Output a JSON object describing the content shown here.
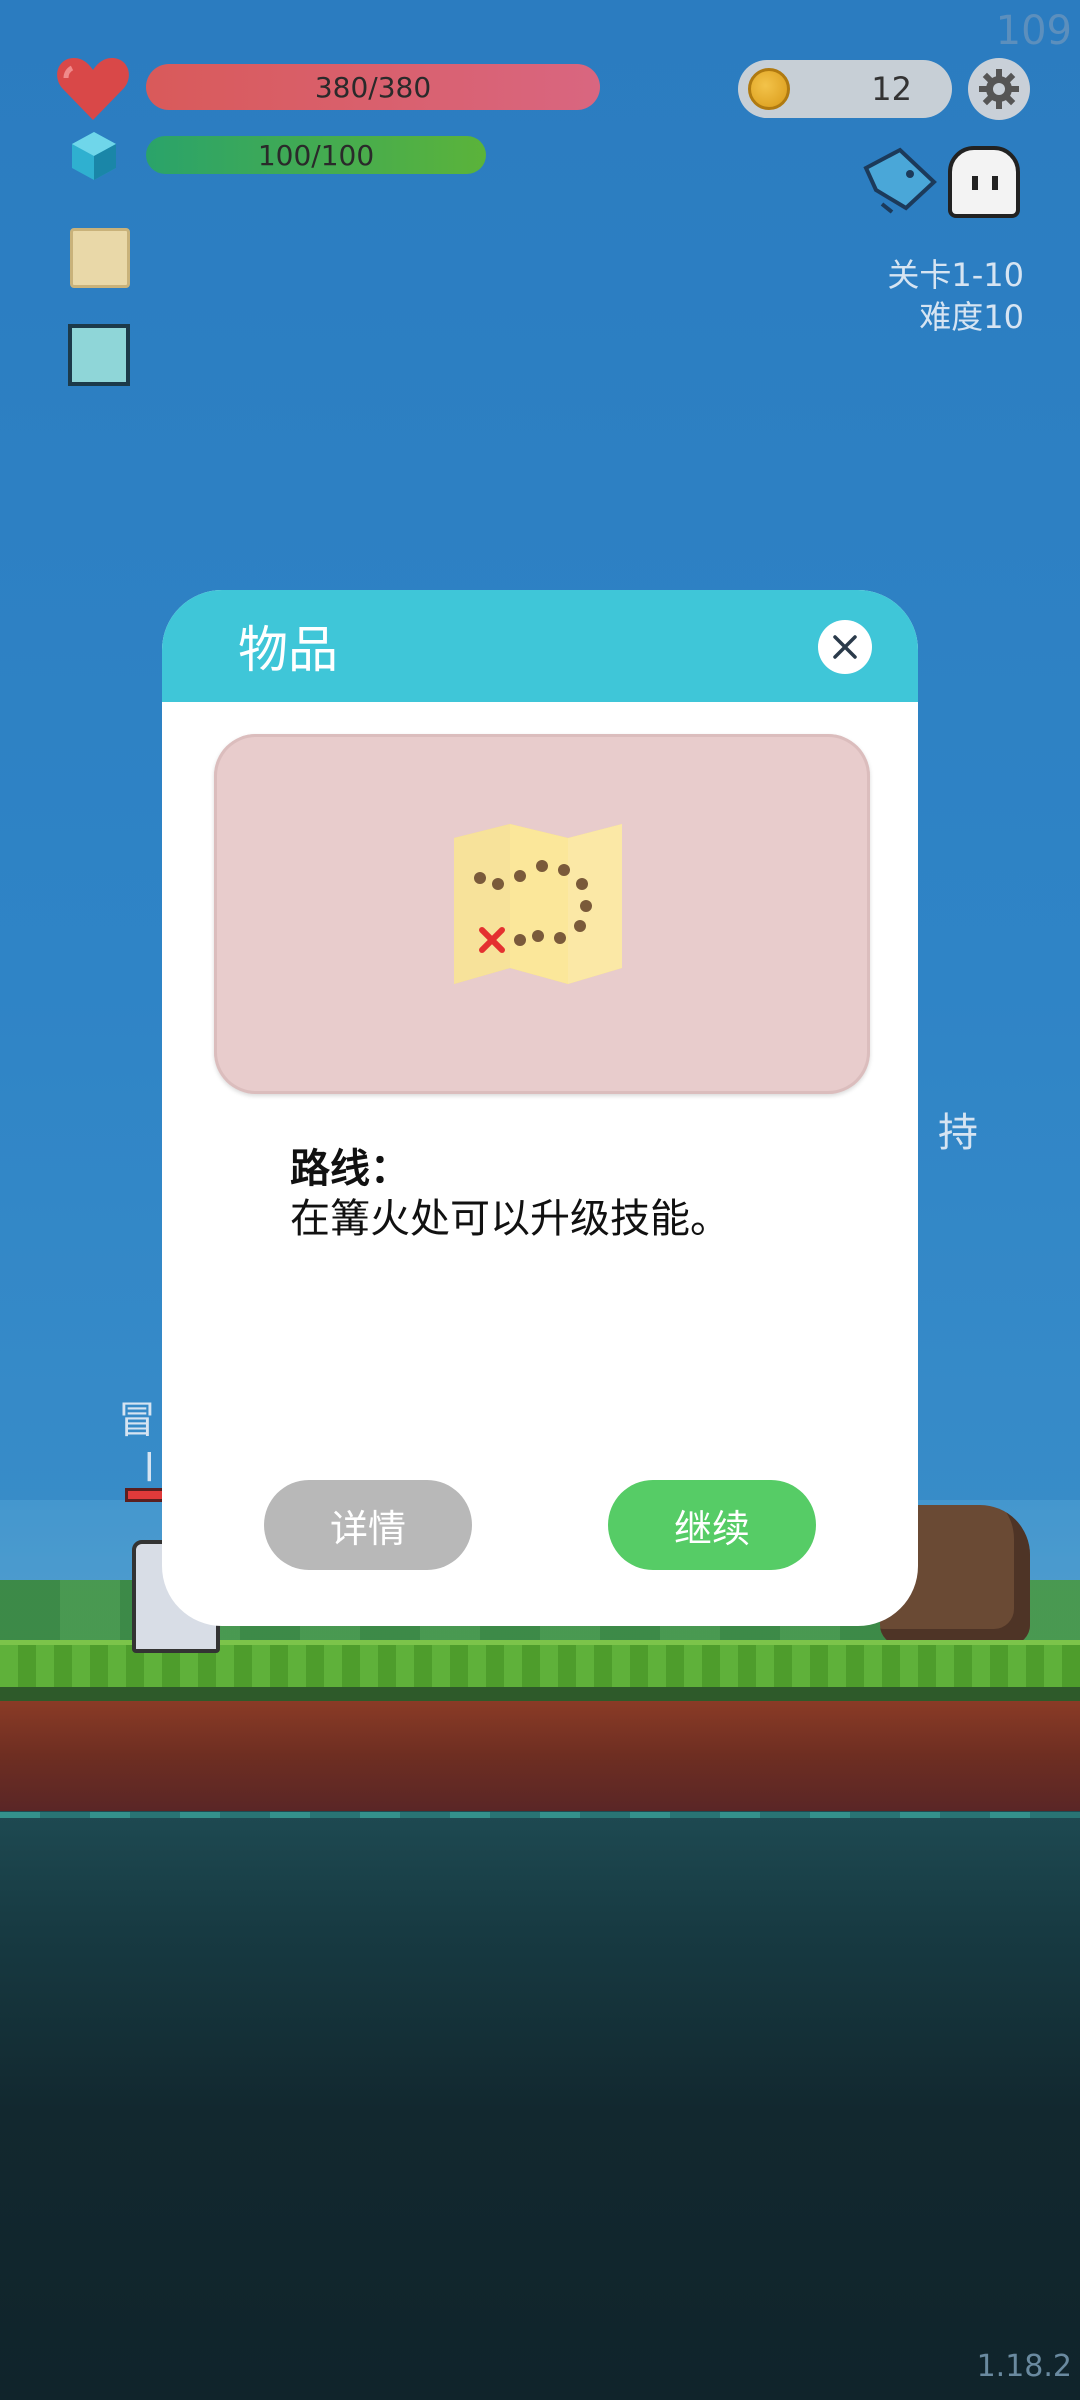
{
  "hud": {
    "hp": "380/380",
    "mp": "100/100",
    "coins": "12",
    "stage": "关卡1-10",
    "difficulty": "难度10",
    "fps": "109",
    "version": "1.18.2"
  },
  "background": {
    "side_text": "持",
    "hero_label_line1": "冒",
    "hero_label_line2": "l"
  },
  "dialog": {
    "title": "物品",
    "item_name": "路线：",
    "item_description": "在篝火处可以升级技能。",
    "details_label": "详情",
    "continue_label": "继续"
  },
  "colors": {
    "header": "#3fc6d8",
    "continue": "#56cc66",
    "details": "#b8b8b8",
    "preview_bg": "#e8cccc"
  },
  "icons": {
    "hp": "heart-icon",
    "mp": "gem-icon",
    "coin": "coin-icon",
    "settings": "gear-icon",
    "map": "map-icon",
    "close": "close-icon"
  }
}
